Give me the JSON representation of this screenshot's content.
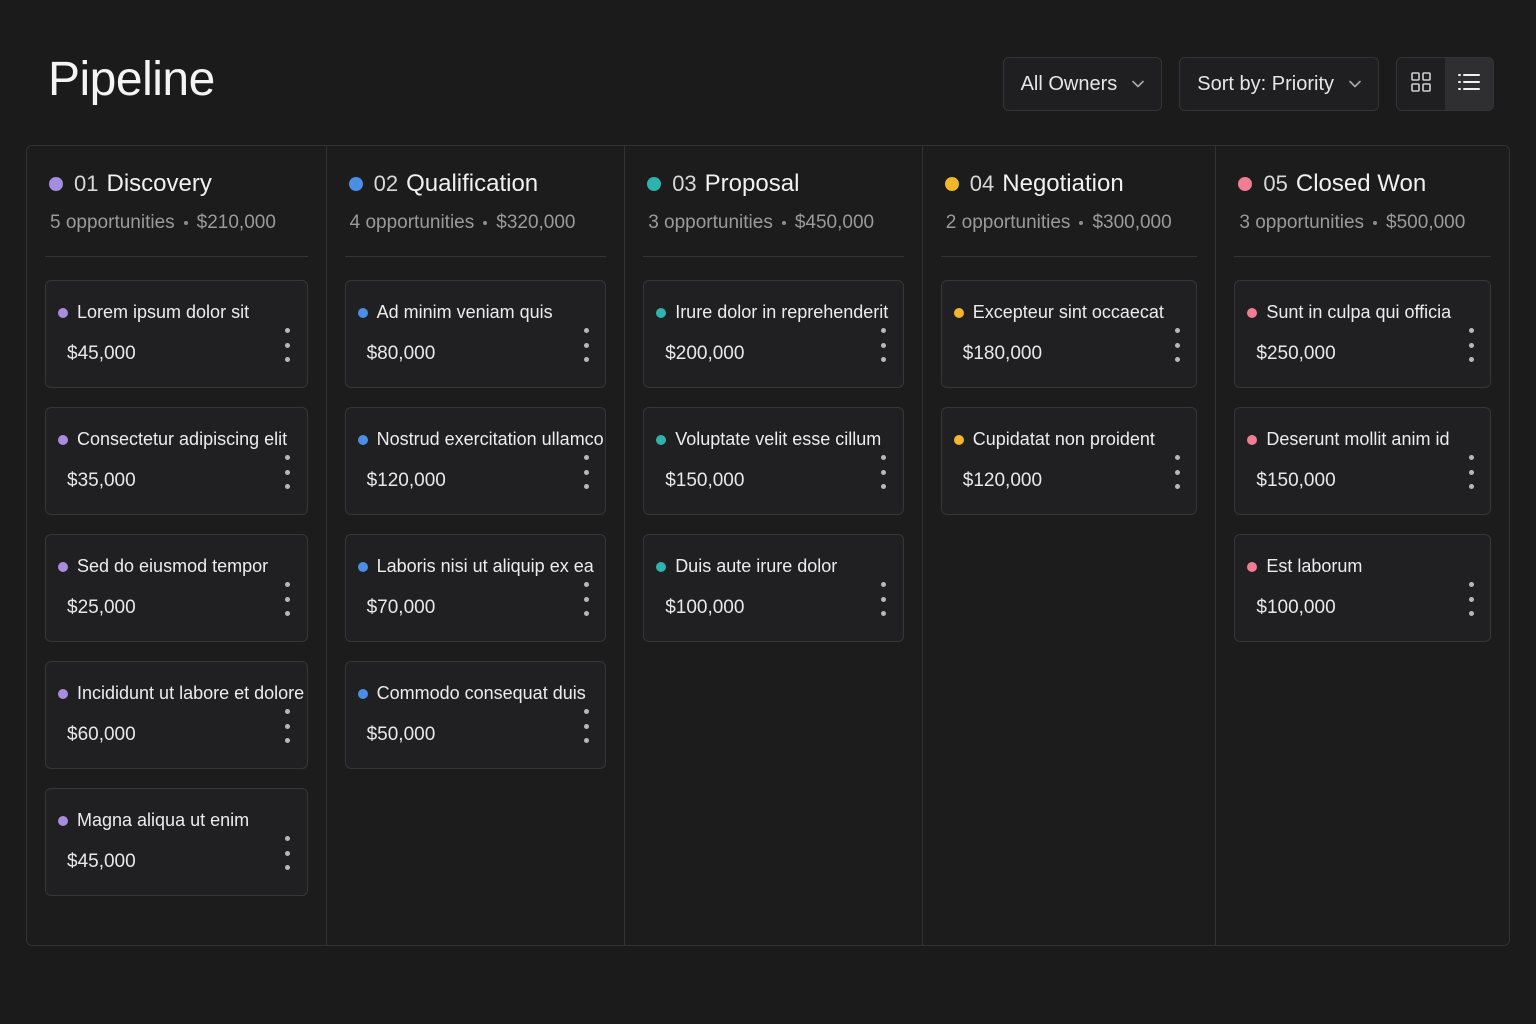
{
  "header": {
    "title": "Pipeline",
    "owner_filter": "All Owners",
    "sort": "Sort by: Priority",
    "view_mode": "list"
  },
  "columns": [
    {
      "num": "01",
      "name": "Discovery",
      "color": "#a58de0",
      "count": "5 opportunities",
      "total": "$210,000",
      "cards": [
        {
          "title": "Lorem ipsum dolor sit",
          "amount": "$45,000"
        },
        {
          "title": "Consectetur adipiscing elit",
          "amount": "$35,000"
        },
        {
          "title": "Sed do eiusmod tempor",
          "amount": "$25,000"
        },
        {
          "title": "Incididunt ut labore et dolore",
          "amount": "$60,000"
        },
        {
          "title": "Magna aliqua ut enim",
          "amount": "$45,000"
        }
      ]
    },
    {
      "num": "02",
      "name": "Qualification",
      "color": "#4a8ee6",
      "count": "4 opportunities",
      "total": "$320,000",
      "cards": [
        {
          "title": "Ad minim veniam quis",
          "amount": "$80,000"
        },
        {
          "title": "Nostrud exercitation ullamco",
          "amount": "$120,000"
        },
        {
          "title": "Laboris nisi ut aliquip ex ea",
          "amount": "$70,000"
        },
        {
          "title": "Commodo consequat duis",
          "amount": "$50,000"
        }
      ]
    },
    {
      "num": "03",
      "name": "Proposal",
      "color": "#2fb3ad",
      "count": "3 opportunities",
      "total": "$450,000",
      "cards": [
        {
          "title": "Irure dolor in reprehenderit",
          "amount": "$200,000"
        },
        {
          "title": "Voluptate velit esse cillum",
          "amount": "$150,000"
        },
        {
          "title": "Duis aute irure dolor",
          "amount": "$100,000"
        }
      ]
    },
    {
      "num": "04",
      "name": "Negotiation",
      "color": "#f1b62b",
      "count": "2 opportunities",
      "total": "$300,000",
      "cards": [
        {
          "title": "Excepteur sint occaecat",
          "amount": "$180,000"
        },
        {
          "title": "Cupidatat non proident",
          "amount": "$120,000"
        }
      ]
    },
    {
      "num": "05",
      "name": "Closed Won",
      "color": "#f07e93",
      "count": "3 opportunities",
      "total": "$500,000",
      "cards": [
        {
          "title": "Sunt in culpa qui officia",
          "amount": "$250,000"
        },
        {
          "title": "Deserunt mollit anim id",
          "amount": "$150,000"
        },
        {
          "title": "Est laborum",
          "amount": "$100,000"
        }
      ]
    }
  ],
  "icons": {
    "owner_chevron": "chevron-down-icon",
    "sort_chevron": "chevron-down-icon",
    "grid_view": "grid-icon",
    "list_view": "list-icon",
    "card_menu": "more-vertical-icon"
  }
}
